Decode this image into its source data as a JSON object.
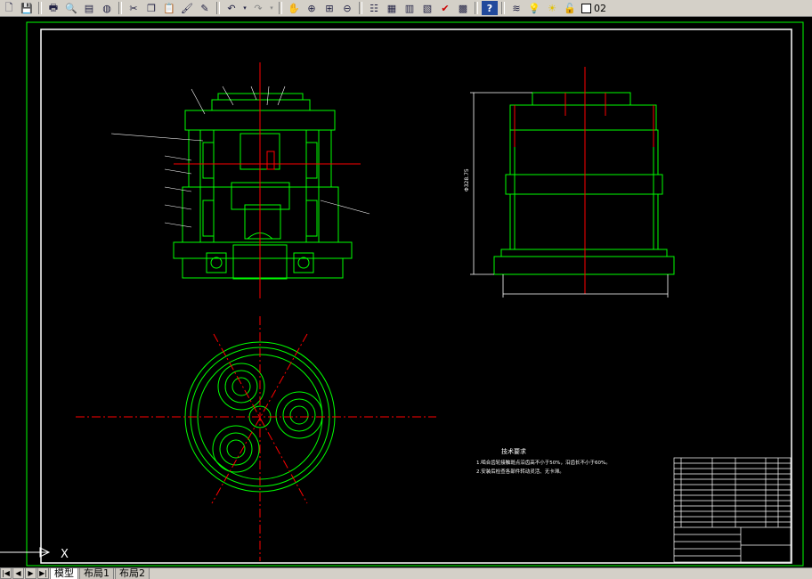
{
  "toolbar": {
    "layer_value": "02",
    "buttons": [
      "new",
      "save",
      "print",
      "preview",
      "publish",
      "cut",
      "copy",
      "paste",
      "match-properties",
      "undo",
      "redo",
      "pan",
      "zoom-realtime",
      "zoom-window",
      "zoom-previous",
      "properties",
      "design-center",
      "tool-palettes",
      "sheet-set",
      "markup",
      "quickcalc",
      "help",
      "layers"
    ]
  },
  "drawing": {
    "tech_req_title": "技术要求",
    "tech_req_lines": [
      "1.啮合齿轮接触斑点沿齿高不小于50%，沿齿长不小于60%。",
      "2.安装后检查各部件转动灵活、无卡滞。"
    ],
    "overall_height_label": "Φ328.75",
    "ucs_x_label": "X"
  },
  "tabs": [
    "模型",
    "布局1",
    "布局2"
  ],
  "colors": {
    "background": "#000000",
    "frame": "#ffffff",
    "geometry": "#00ff00",
    "centerline": "#ff0000",
    "dimension": "#ffffff"
  }
}
